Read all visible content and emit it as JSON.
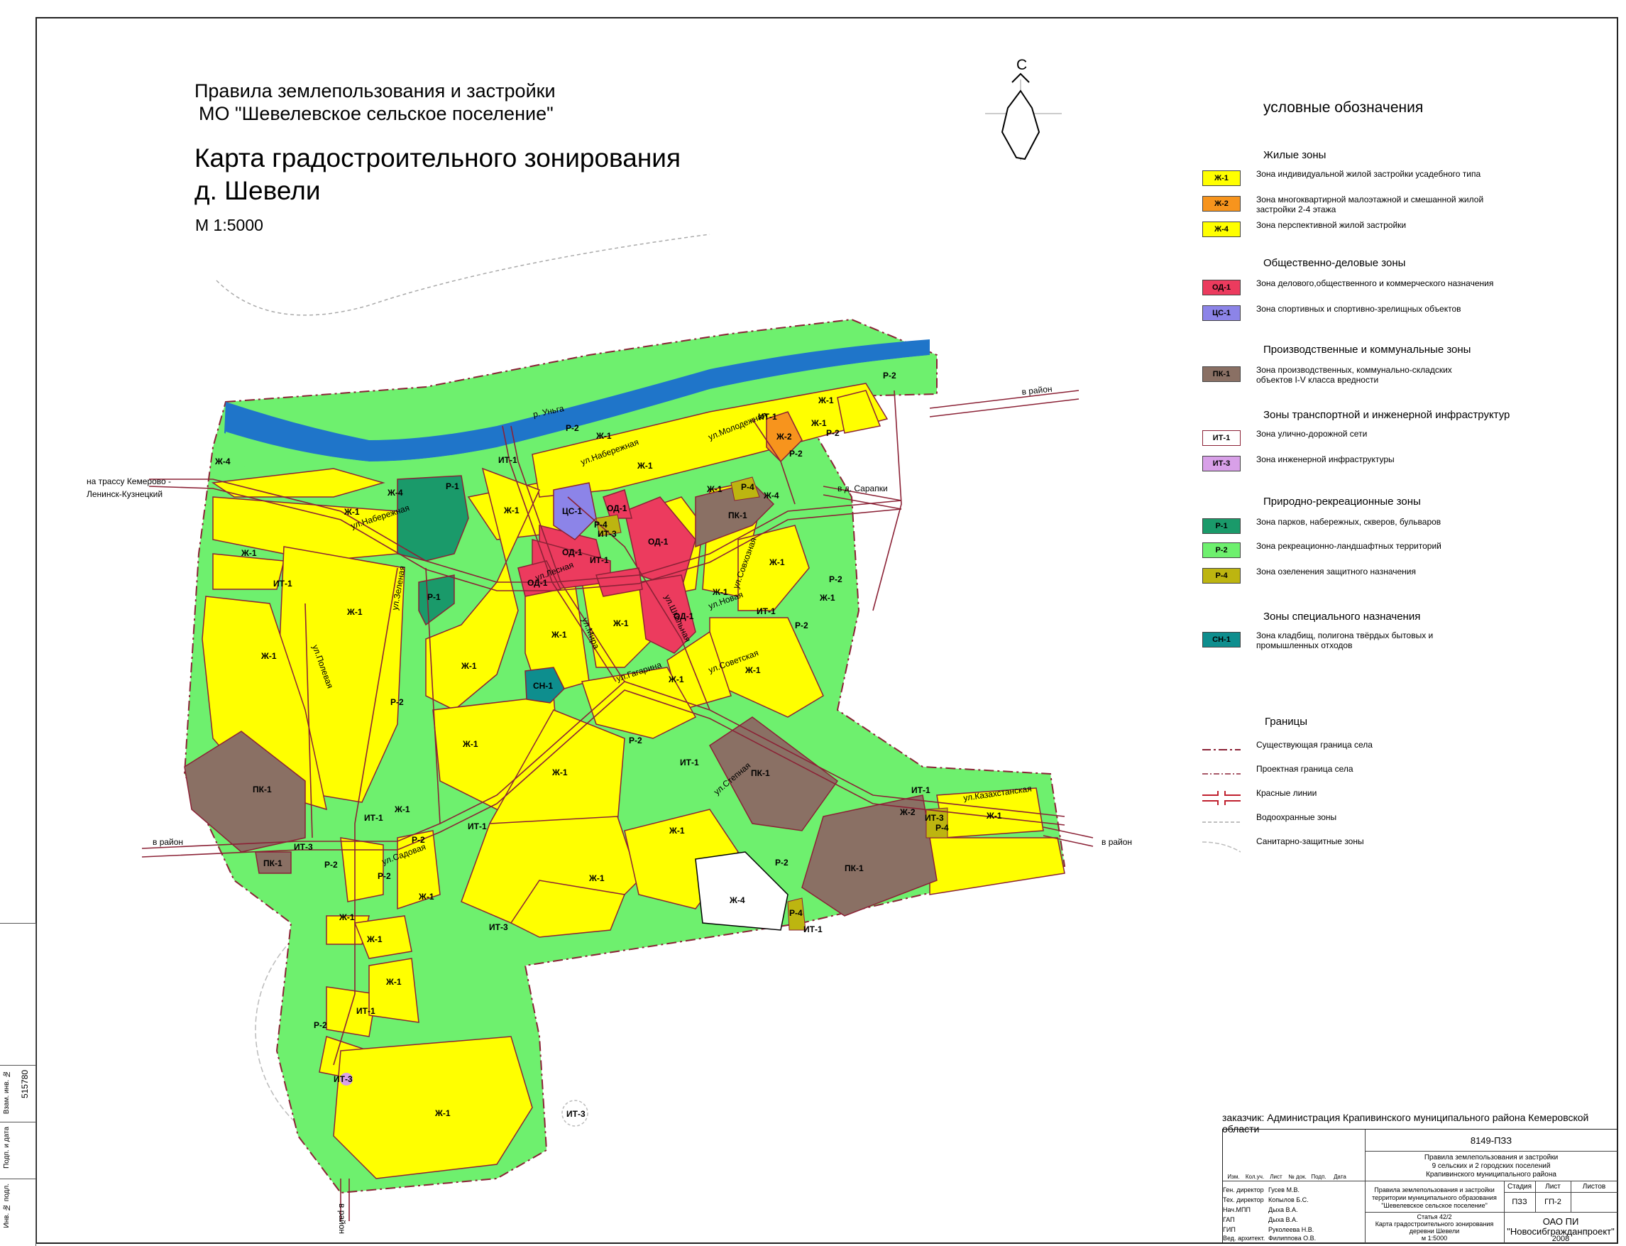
{
  "header": {
    "title_line1": "Правила землепользования и застройки",
    "title_line2": "МО \"Шевелевское сельское поселение\"",
    "map_title_line1": "Карта градостроительного зонирования",
    "map_title_line2": "д. Шевели",
    "scale": "М 1:5000"
  },
  "north_arrow": {
    "label": "С"
  },
  "map": {
    "place_labels": [
      {
        "id": "river",
        "text": "р. Уньга"
      },
      {
        "id": "to-kemerovo-1",
        "text": "на трассу Кемерово -"
      },
      {
        "id": "to-kemerovo-2",
        "text": "Ленинск-Кузнецкий"
      },
      {
        "id": "to-rayon-ne",
        "text": "в район"
      },
      {
        "id": "to-sarapki",
        "text": "в д. Сарапки"
      },
      {
        "id": "to-rayon-w",
        "text": "в район"
      },
      {
        "id": "to-rayon-e",
        "text": "в район"
      },
      {
        "id": "to-rayon-s",
        "text": "в район"
      }
    ],
    "street_labels": [
      "ул.Набережная",
      "ул.Набережная",
      "ул.Молодежная",
      "ул.Гагарина",
      "ул.Мира",
      "ул.Советская",
      "ул.Садовая",
      "ул.Лесная",
      "ул.Совхозная",
      "ул.Школьная",
      "ул.Полевая",
      "ул.Зеленая",
      "ул.Новая",
      "ул.Казахстанская",
      "ул.Степная"
    ],
    "zone_labels": [
      "Ж-1",
      "Ж-1",
      "Ж-1",
      "Ж-1",
      "Ж-1",
      "Ж-1",
      "Ж-1",
      "Ж-1",
      "Ж-1",
      "Ж-1",
      "Ж-1",
      "Ж-1",
      "Ж-1",
      "Ж-1",
      "Ж-1",
      "Ж-1",
      "Ж-1",
      "Ж-1",
      "Ж-1",
      "Ж-1",
      "Ж-1",
      "Ж-1",
      "Ж-1",
      "Ж-1",
      "Ж-1",
      "Ж-1",
      "Ж-1",
      "Ж-1",
      "Ж-1",
      "Ж-2",
      "Ж-2",
      "Ж-4",
      "Ж-4",
      "Ж-4",
      "Ж-4",
      "ОД-1",
      "ОД-1",
      "ОД-1",
      "ОД-1",
      "ОД-1",
      "ЦС-1",
      "ПК-1",
      "ПК-1",
      "ПК-1",
      "ПК-1",
      "ПК-1",
      "Р-1",
      "Р-1",
      "Р-2",
      "Р-2",
      "Р-2",
      "Р-2",
      "Р-2",
      "Р-2",
      "Р-2",
      "Р-2",
      "Р-2",
      "Р-2",
      "Р-2",
      "Р-2",
      "Р-2",
      "Р-4",
      "Р-4",
      "Р-4",
      "Р-4",
      "СН-1",
      "ИТ-1",
      "ИТ-1",
      "ИТ-1",
      "ИТ-1",
      "ИТ-1",
      "ИТ-1",
      "ИТ-1",
      "ИТ-1",
      "ИТ-1",
      "ИТ-1",
      "ИТ-1",
      "ИТ-3",
      "ИТ-3",
      "ИТ-3",
      "ИТ-3",
      "ИТ-3",
      "ИТ-3"
    ]
  },
  "legend": {
    "title": "условные обозначения",
    "sections": [
      {
        "name": "Жилые зоны",
        "items": [
          {
            "code": "Ж-1",
            "color": "#ffff00",
            "text": "Зона индивидуальной жилой застройки усадебного типа"
          },
          {
            "code": "Ж-2",
            "color": "#f7941d",
            "text": "Зона многоквартирной малоэтажной  и смешанной жилой застройки 2-4 этажа"
          },
          {
            "code": "Ж-4",
            "color": "#ffff00",
            "text": "Зона перспективной жилой застройки"
          }
        ]
      },
      {
        "name": "Общественно-деловые зоны",
        "items": [
          {
            "code": "ОД-1",
            "color": "#ec3b5e",
            "text": "Зона делового,общественного и коммерческого назначения"
          },
          {
            "code": "ЦС-1",
            "color": "#8c84e8",
            "text": "Зона спортивных и спортивно-зрелищных объектов"
          }
        ]
      },
      {
        "name": "Производственные и коммунальные зоны",
        "items": [
          {
            "code": "ПК-1",
            "color": "#8a7064",
            "text": "Зона производственных,  коммунально-складских объектов I-V класса вредности"
          }
        ]
      },
      {
        "name": "Зоны транспортной и инженерной инфраструктур",
        "items": [
          {
            "code": "ИТ-1",
            "color": "#ffffff",
            "text": "Зона улично-дорожной сети"
          },
          {
            "code": "ИТ-3",
            "color": "#d8a0e8",
            "text": "Зона инженерной инфраструктуры"
          }
        ]
      },
      {
        "name": "Природно-рекреационные зоны",
        "items": [
          {
            "code": "Р-1",
            "color": "#1a9a6a",
            "text": "Зона парков, набережных, скверов, бульваров"
          },
          {
            "code": "Р-2",
            "color": "#6ef06e",
            "text": "Зона рекреационно-ландшафтных территорий"
          },
          {
            "code": "Р-4",
            "color": "#bdb510",
            "text": "Зона озеленения защитного назначения"
          }
        ]
      },
      {
        "name": "Зоны специального назначения",
        "items": [
          {
            "code": "СН-1",
            "color": "#0e8e8e",
            "text": "Зона кладбищ, полигона твёрдых бытовых и промышленных отходов"
          }
        ]
      }
    ],
    "borders_title": "Границы",
    "borders": [
      {
        "text": "Существующая граница села"
      },
      {
        "text": "Проектная граница села"
      },
      {
        "text": "Красные линии"
      },
      {
        "text": "Водоохранные зоны"
      },
      {
        "text": "Санитарно-защитные зоны"
      }
    ]
  },
  "stamp": {
    "customer": "заказчик: Администрация Крапивинского муниципального района Кемеровской области",
    "code": "8149-ПЗЗ",
    "project_1": "Правила землепользования и застройки",
    "project_2": "9 сельских и 2 городских поселений",
    "project_3": "Крапивинского муниципального района",
    "cols": [
      "Изм.",
      "Кол.уч.",
      "Лист",
      "№ док.",
      "Подп.",
      "Дата"
    ],
    "people": [
      {
        "role": "Ген. директор",
        "name": "Гусев М.В."
      },
      {
        "role": "Тех. директор",
        "name": "Копылов Б.С."
      },
      {
        "role": "Нач.МПП",
        "name": "Дыха В.А."
      },
      {
        "role": "ГАП",
        "name": "Дыха В.А."
      },
      {
        "role": "ГИП",
        "name": "Руколеева Н.В."
      },
      {
        "role": "Вед. архитект.",
        "name": "Филиппова О.В."
      }
    ],
    "doc_1": "Правила землепользования и застройки",
    "doc_2": "территории муниципального образования",
    "doc_3": "\"Шевелевское сельское поселение\"",
    "article_1": "Статья 42/2",
    "article_2": "Карта градостроительного зонирования",
    "article_3": "деревни Шевели",
    "article_4": "м 1:5000",
    "stage_h": "Стадия",
    "sheet_h": "Лист",
    "sheets_h": "Листов",
    "stage": "ПЗЗ",
    "sheet": "ГП-2",
    "sheets": "",
    "org_1": "ОАО ПИ",
    "org_2": "\"Новосибгражданпроект\"",
    "year": "2008"
  },
  "side_strip": {
    "inv_label": "Взам. инв. №",
    "inv_value": "515780",
    "sign_label": "Подп. и дата",
    "orig_label": "Инв. № подл."
  }
}
